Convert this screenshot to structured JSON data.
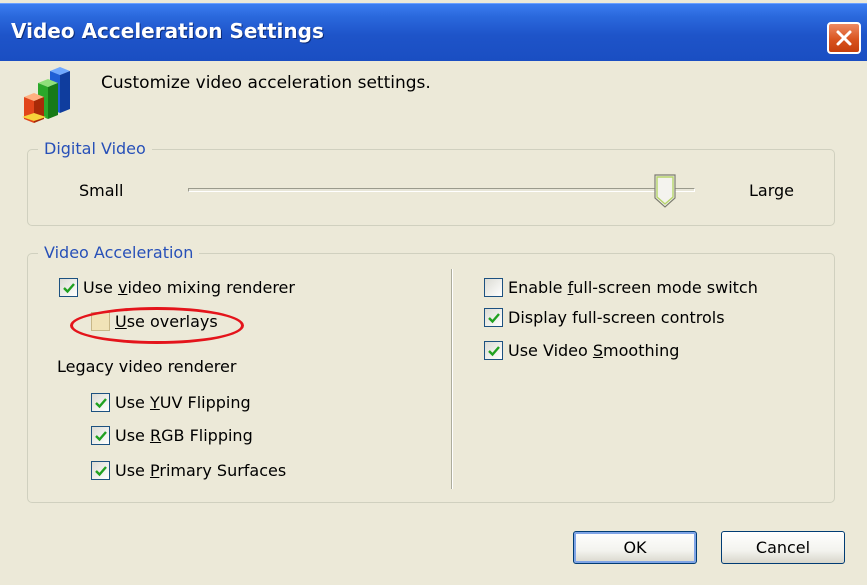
{
  "window": {
    "title": "Video Acceleration Settings",
    "close_icon": "close-x-icon"
  },
  "header": {
    "icon": "bar-chart-icon",
    "text": "Customize video acceleration settings."
  },
  "digital_video": {
    "legend": "Digital Video",
    "small_label": "Small",
    "large_label": "Large",
    "slider_level": 0.94
  },
  "video_acceleration": {
    "legend": "Video Acceleration",
    "legacy_label": "Legacy video renderer",
    "left_options": [
      {
        "label_pre": "Use ",
        "label_u": "v",
        "label_post": "ideo mixing renderer",
        "checked": true
      },
      {
        "label_pre": "",
        "label_u": "U",
        "label_post": "se overlays",
        "checked": false,
        "disabled": true,
        "highlighted": true
      },
      {
        "label_pre": "Use ",
        "label_u": "Y",
        "label_post": "UV Flipping",
        "checked": true
      },
      {
        "label_pre": "Use ",
        "label_u": "R",
        "label_post": "GB Flipping",
        "checked": true
      },
      {
        "label_pre": "Use ",
        "label_u": "P",
        "label_post": "rimary Surfaces",
        "checked": true
      }
    ],
    "right_options": [
      {
        "label_pre": "Enable ",
        "label_u": "f",
        "label_post": "ull-screen mode switch",
        "checked": false
      },
      {
        "label_pre": "Display full-screen controls",
        "label_u": "",
        "label_post": "",
        "checked": true
      },
      {
        "label_pre": "Use Video ",
        "label_u": "S",
        "label_post": "moothing",
        "checked": true
      }
    ]
  },
  "buttons": {
    "ok": "OK",
    "cancel": "Cancel"
  },
  "colors": {
    "titlebar": "#1e54c9",
    "legend_text": "#2750b8",
    "highlight_ellipse": "#e4141b",
    "check_mark": "#21a121"
  }
}
